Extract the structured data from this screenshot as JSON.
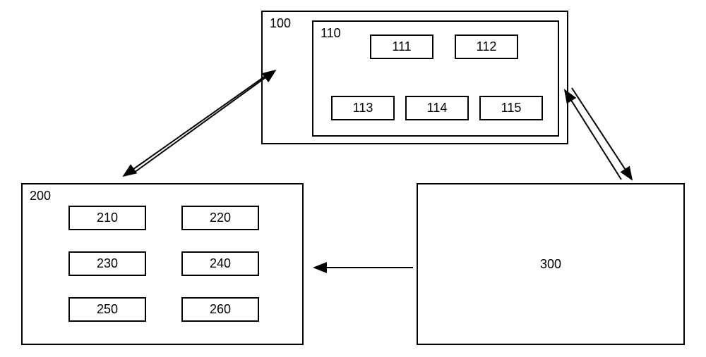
{
  "block100": {
    "label": "100",
    "inner": {
      "label": "110",
      "items": [
        "111",
        "112",
        "113",
        "114",
        "115"
      ]
    }
  },
  "block200": {
    "label": "200",
    "items": [
      "210",
      "220",
      "230",
      "240",
      "250",
      "260"
    ]
  },
  "block300": {
    "label": "300"
  }
}
